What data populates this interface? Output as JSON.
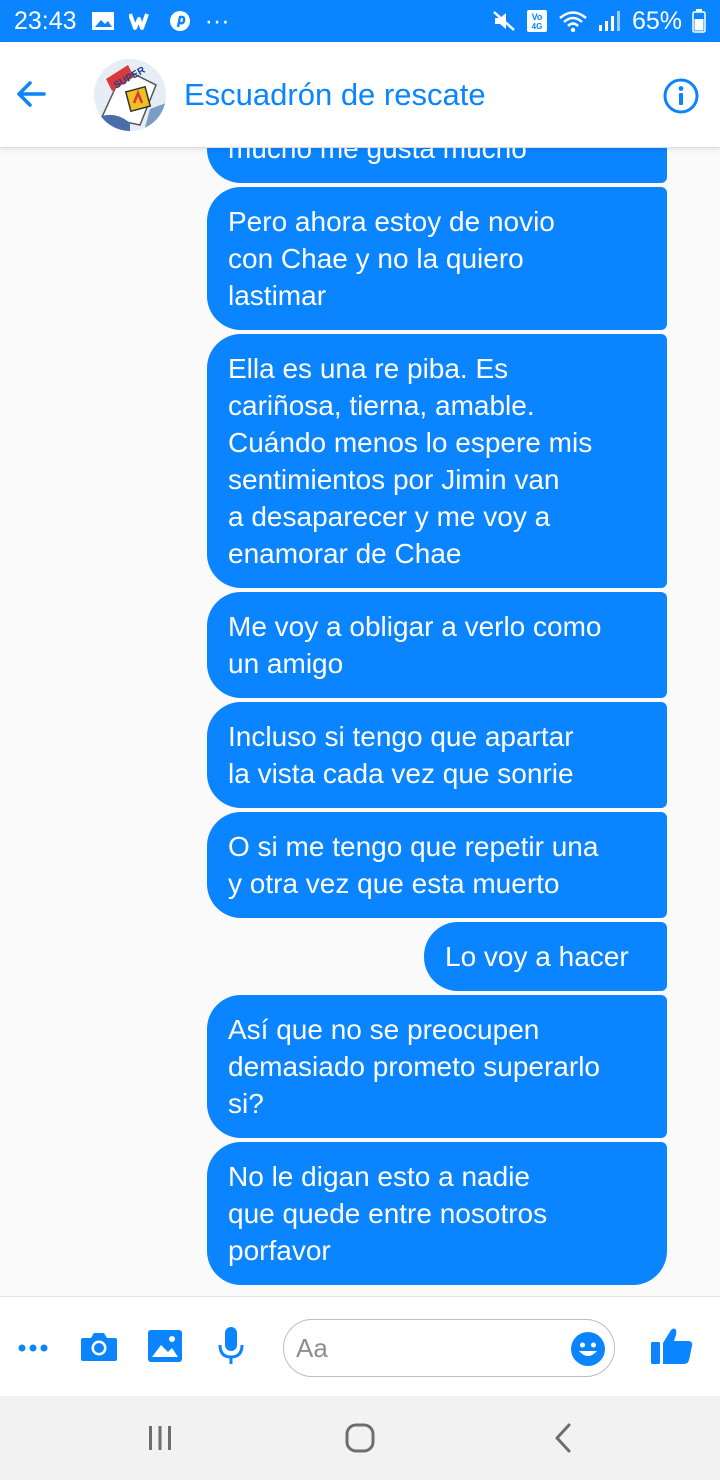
{
  "status_bar": {
    "time": "23:43",
    "notification_icons": [
      "gallery-icon",
      "wattpad-icon",
      "pinterest-icon"
    ],
    "more_label": "···",
    "volte_badge": "Vo 4G",
    "battery": "65%"
  },
  "header": {
    "title": "Escuadrón de rescate",
    "avatar_text": "SUPER"
  },
  "messages": [
    {
      "text": "mucho me gusta mucho"
    },
    {
      "text": "Pero ahora estoy de novio\ncon Chae y no la quiero\nlastimar"
    },
    {
      "text": "Ella es una re piba. Es\ncariñosa, tierna, amable.\nCuándo menos lo espere mis\nsentimientos por Jimin van\na desaparecer y me voy a\nenamorar de Chae"
    },
    {
      "text": "Me voy a obligar a verlo como\nun amigo"
    },
    {
      "text": "Incluso si tengo que apartar\nla vista cada vez que sonrie"
    },
    {
      "text": "O si me tengo que repetir una\ny otra vez que esta muerto"
    },
    {
      "text": "Lo voy a hacer"
    },
    {
      "text": "Así que no se preocupen\ndemasiado prometo superarlo\nsi?"
    },
    {
      "text": "No le digan esto a nadie\nque quede entre nosotros\nporfavor"
    }
  ],
  "composer": {
    "placeholder": "Aa"
  },
  "colors": {
    "accent": "#0a84ff",
    "bubble": "#0a84ff",
    "background": "#fafafa"
  }
}
